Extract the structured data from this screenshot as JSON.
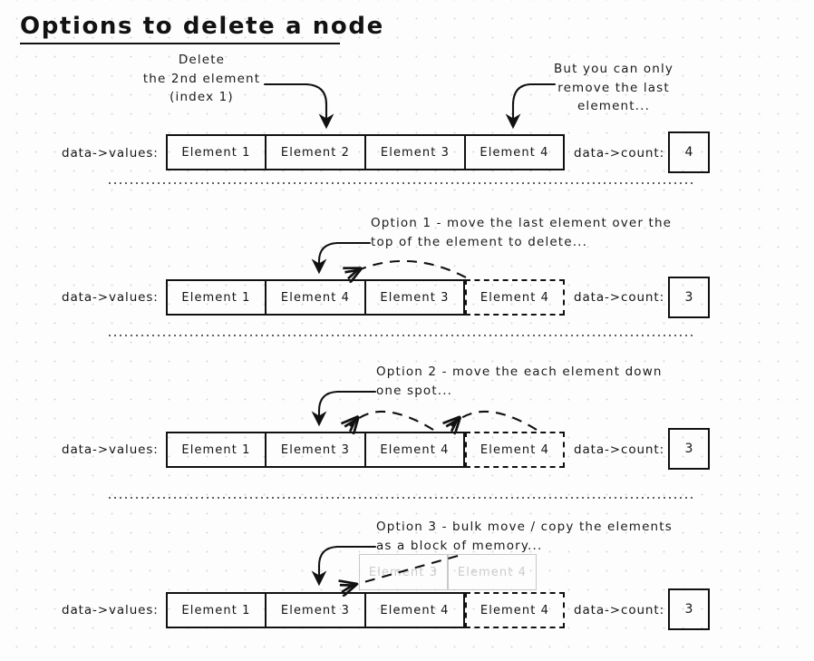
{
  "title": "Options to delete a node",
  "labels": {
    "values": "data->values:",
    "count": "data->count:"
  },
  "annotations": {
    "delete_note": [
      "Delete",
      "the 2nd element",
      "(index 1)"
    ],
    "remove_last_note": [
      "But you can only",
      "remove the last",
      "element..."
    ],
    "option1": [
      "Option 1 - move the last element over the",
      "top of the element to delete..."
    ],
    "option2": [
      "Option 2 - move the each element down",
      "one spot..."
    ],
    "option3": [
      "Option 3 - bulk move / copy the elements",
      "as a block of memory..."
    ]
  },
  "rows": [
    {
      "name": "initial",
      "cells": [
        {
          "text": "Element 1",
          "ghost": false
        },
        {
          "text": "Element 2",
          "ghost": false
        },
        {
          "text": "Element 3",
          "ghost": false
        },
        {
          "text": "Element 4",
          "ghost": false
        }
      ],
      "count": "4"
    },
    {
      "name": "option1",
      "cells": [
        {
          "text": "Element 1",
          "ghost": false
        },
        {
          "text": "Element 4",
          "ghost": false
        },
        {
          "text": "Element 3",
          "ghost": false
        },
        {
          "text": "Element 4",
          "ghost": true
        }
      ],
      "count": "3"
    },
    {
      "name": "option2",
      "cells": [
        {
          "text": "Element 1",
          "ghost": false
        },
        {
          "text": "Element 3",
          "ghost": false
        },
        {
          "text": "Element 4",
          "ghost": false
        },
        {
          "text": "Element 4",
          "ghost": true
        }
      ],
      "count": "3"
    },
    {
      "name": "option3",
      "cells": [
        {
          "text": "Element 1",
          "ghost": false
        },
        {
          "text": "Element 3",
          "ghost": false
        },
        {
          "text": "Element 4",
          "ghost": false
        },
        {
          "text": "Element 4",
          "ghost": true
        }
      ],
      "count": "3"
    }
  ],
  "memory_block": {
    "cells": [
      "Element 3",
      "Element 4"
    ]
  },
  "colors": {
    "ink": "#111111",
    "ghost": "#cccccc",
    "grid_dot": "#d8d8dd",
    "paper": "#fdfdfd"
  }
}
